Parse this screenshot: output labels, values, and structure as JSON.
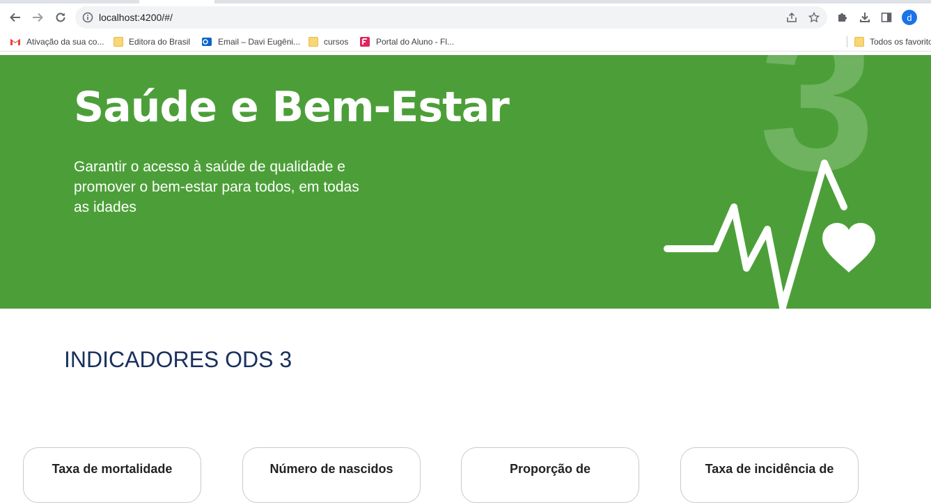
{
  "browser": {
    "url": "localhost:4200/#/",
    "avatar_letter": "d",
    "bookmarks": [
      {
        "label": "Ativação da sua co...",
        "icon": "gmail-icon"
      },
      {
        "label": "Editora do Brasil",
        "icon": "folder-icon"
      },
      {
        "label": "Email – Davi Eugêni...",
        "icon": "outlook-icon"
      },
      {
        "label": "cursos",
        "icon": "folder-icon"
      },
      {
        "label": "Portal do Aluno - Fl...",
        "icon": "portal-icon"
      }
    ],
    "other_bookmarks": "Todos os favoritos"
  },
  "hero": {
    "title": "Saúde e Bem-Estar",
    "subtitle": "Garantir o acesso à saúde de qualidade e promover o bem-estar para todos, em todas as idades",
    "number": "3",
    "background_color": "#4c9f38"
  },
  "section": {
    "title": "INDICADORES ODS 3"
  },
  "cards": [
    {
      "title": "Taxa de mortalidade"
    },
    {
      "title": "Número de nascidos"
    },
    {
      "title": "Proporção de"
    },
    {
      "title": "Taxa de incidência de"
    }
  ]
}
